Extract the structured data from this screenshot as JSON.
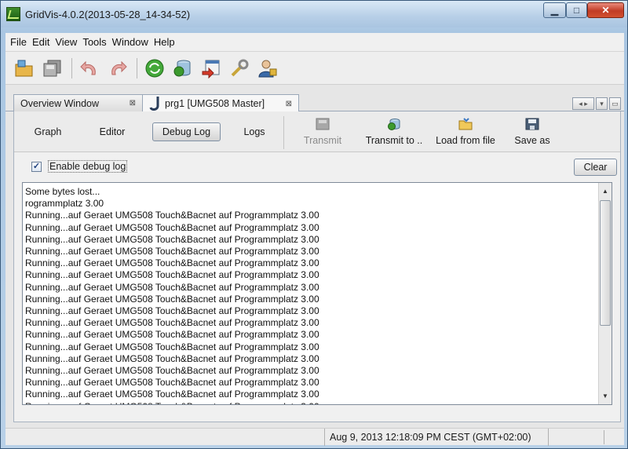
{
  "window": {
    "title": "GridVis-4.0.2(2013-05-28_14-34-52)"
  },
  "menu": [
    "File",
    "Edit",
    "View",
    "Tools",
    "Window",
    "Help"
  ],
  "tabs": {
    "overview": "Overview Window",
    "prg1": "prg1 [UMG508 Master]",
    "close_glyph": "⊠"
  },
  "subtabs": {
    "graph": "Graph",
    "editor": "Editor",
    "debug_log": "Debug Log",
    "logs": "Logs"
  },
  "actions": {
    "transmit": "Transmit",
    "transmit_to": "Transmit to ..",
    "load_from_file": "Load from file",
    "save_as": "Save as"
  },
  "debug": {
    "enable_label": "Enable debug log",
    "enabled": true,
    "clear_label": "Clear"
  },
  "log_lines": [
    "Some bytes lost...",
    "rogrammplatz 3.00",
    "Running...auf Geraet UMG508 Touch&Bacnet auf Programmplatz 3.00",
    "Running...auf Geraet UMG508 Touch&Bacnet auf Programmplatz 3.00",
    "Running...auf Geraet UMG508 Touch&Bacnet auf Programmplatz 3.00",
    "Running...auf Geraet UMG508 Touch&Bacnet auf Programmplatz 3.00",
    "Running...auf Geraet UMG508 Touch&Bacnet auf Programmplatz 3.00",
    "Running...auf Geraet UMG508 Touch&Bacnet auf Programmplatz 3.00",
    "Running...auf Geraet UMG508 Touch&Bacnet auf Programmplatz 3.00",
    "Running...auf Geraet UMG508 Touch&Bacnet auf Programmplatz 3.00",
    "Running...auf Geraet UMG508 Touch&Bacnet auf Programmplatz 3.00",
    "Running...auf Geraet UMG508 Touch&Bacnet auf Programmplatz 3.00",
    "Running...auf Geraet UMG508 Touch&Bacnet auf Programmplatz 3.00",
    "Running...auf Geraet UMG508 Touch&Bacnet auf Programmplatz 3.00",
    "Running...auf Geraet UMG508 Touch&Bacnet auf Programmplatz 3.00",
    "Running...auf Geraet UMG508 Touch&Bacnet auf Programmplatz 3.00",
    "Running...auf Geraet UMG508 Touch&Bacnet auf Programmplatz 3.00",
    "Running...auf Geraet UMG508 Touch&Bacnet auf Programmplatz 3.00",
    "Running...auf Geraet UMG508 Touch&Bacnet auf Programmplatz 3.00"
  ],
  "status": {
    "time": "Aug 9, 2013 12:18:09 PM CEST (GMT+02:00)"
  },
  "toolbar_icons": [
    "new-folder-icon",
    "save-all-icon",
    "undo-icon",
    "redo-icon",
    "sync-icon",
    "database-icon",
    "import-icon",
    "tools-icon",
    "user-icon"
  ],
  "colors": {
    "title_bar": "#b7cfe7",
    "close_button": "#c13c25",
    "accent_green": "#3c9a2e"
  }
}
